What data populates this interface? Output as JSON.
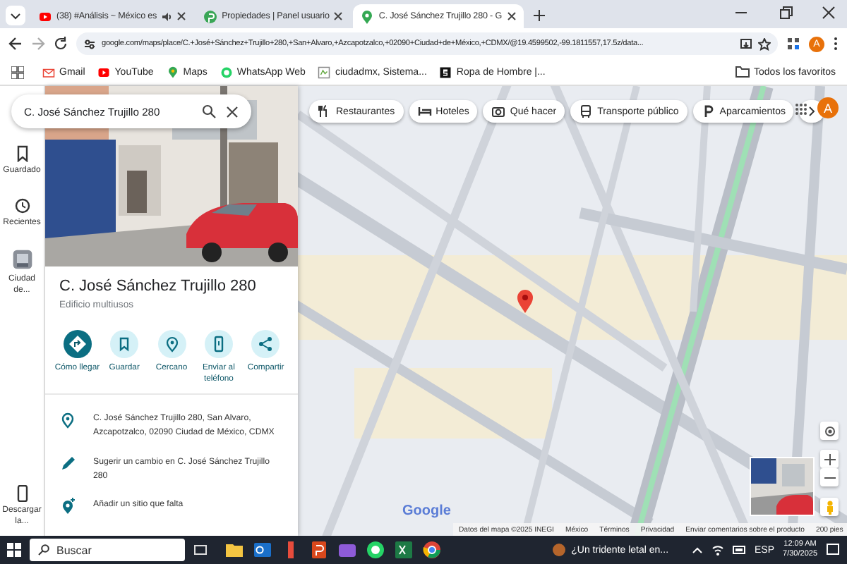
{
  "browser": {
    "tabs": [
      {
        "title": "(38) #Análisis ~ México es",
        "selected": false,
        "audio": true
      },
      {
        "title": "Propiedades | Panel usuario",
        "selected": false,
        "audio": false
      },
      {
        "title": "C. José Sánchez Trujillo 280 - G",
        "selected": true,
        "audio": false
      }
    ],
    "address": "google.com/maps/place/C.+José+Sánchez+Trujillo+280,+San+Alvaro,+Azcapotzalco,+02090+Ciudad+de+México,+CDMX/@19.4599502,-99.1811557,17.5z/data...",
    "profile": "A",
    "bookmarks": [
      {
        "label": "Gmail",
        "kind": "mail"
      },
      {
        "label": "YouTube",
        "kind": "video"
      },
      {
        "label": "Maps",
        "kind": "pin"
      },
      {
        "label": "WhatsApp Web",
        "kind": "chat"
      },
      {
        "label": "ciudadmx, Sistema...",
        "kind": "site"
      },
      {
        "label": "Ropa de Hombre |...",
        "kind": "letter"
      }
    ],
    "all_bookmarks": "Todos los favoritos"
  },
  "rail": [
    {
      "label": "Guardado",
      "kind": "bookmark"
    },
    {
      "label": "Recientes",
      "kind": "history"
    },
    {
      "label": "Ciudad de...",
      "kind": "thumb"
    }
  ],
  "rail_bottom": {
    "label": "Descargar la...",
    "kind": "phone"
  },
  "search": {
    "value": "C. José Sánchez Trujillo 280"
  },
  "place": {
    "title": "C. José Sánchez Trujillo 280",
    "subtitle": "Edificio multiusos",
    "actions": [
      {
        "label": "Cómo llegar",
        "kind": "directions"
      },
      {
        "label": "Guardar",
        "kind": "save"
      },
      {
        "label": "Cercano",
        "kind": "nearby"
      },
      {
        "label": "Enviar al teléfono",
        "kind": "phone"
      },
      {
        "label": "Compartir",
        "kind": "share"
      }
    ],
    "details": [
      {
        "kind": "address",
        "text": "C. José Sánchez Trujillo 280, San Alvaro, Azcapotzalco, 02090 Ciudad de México, CDMX"
      },
      {
        "kind": "edit",
        "text": "Sugerir un cambio en C. José Sánchez Trujillo 280"
      },
      {
        "kind": "add",
        "text": "Añadir un sitio que falta"
      }
    ]
  },
  "map": {
    "chips": [
      {
        "label": "Restaurantes",
        "kind": "food"
      },
      {
        "label": "Hoteles",
        "kind": "bed"
      },
      {
        "label": "Qué hacer",
        "kind": "camera"
      },
      {
        "label": "Transporte público",
        "kind": "bus"
      },
      {
        "label": "Aparcamientos",
        "kind": "parking"
      }
    ],
    "profile": "A",
    "logo": "Google",
    "footer": [
      "Datos del mapa ©2025 INEGI",
      "México",
      "Términos",
      "Privacidad",
      "Enviar comentarios sobre el producto"
    ],
    "scale": "200 pies"
  },
  "taskbar": {
    "search": "Buscar",
    "apps": [
      {
        "kind": "folder"
      },
      {
        "kind": "outlook"
      },
      {
        "kind": "app"
      },
      {
        "kind": "office"
      },
      {
        "kind": "media"
      },
      {
        "kind": "chat"
      },
      {
        "kind": "sheet"
      },
      {
        "kind": "browser"
      }
    ],
    "news": "¿Un tridente letal en...",
    "lang": "ESP",
    "time": "12:09 AM",
    "date": "7/30/2025"
  }
}
